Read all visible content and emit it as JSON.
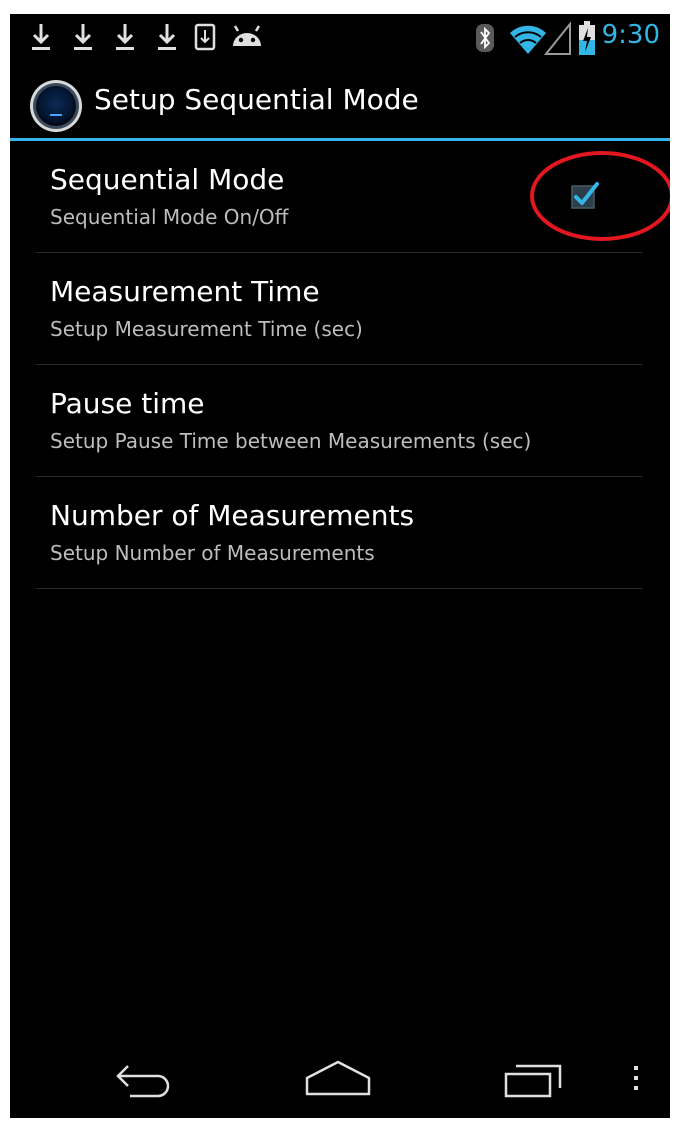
{
  "status_bar": {
    "notification_icons": [
      "download-icon",
      "download-icon",
      "download-icon",
      "download-icon",
      "sd-download-icon",
      "android-icon"
    ],
    "system_icons": [
      "bluetooth-icon",
      "wifi-icon",
      "signal-icon",
      "battery-charging-icon"
    ],
    "time": "9:30"
  },
  "action_bar": {
    "icon": "app-icon",
    "title": "Setup Sequential Mode"
  },
  "preferences": [
    {
      "title": "Sequential Mode",
      "summary": "Sequential Mode On/Off",
      "checked": true
    },
    {
      "title": "Measurement Time",
      "summary": "Setup Measurement Time (sec)"
    },
    {
      "title": "Pause time",
      "summary": "Setup Pause Time between Measurements (sec)"
    },
    {
      "title": "Number of Measurements",
      "summary": "Setup Number of Measurements"
    }
  ],
  "navigation_bar": {
    "buttons": [
      "back-icon",
      "home-icon",
      "recent-apps-icon",
      "overflow-menu-icon"
    ]
  },
  "colors": {
    "accent": "#33b5e5",
    "annotation": "#e3171f",
    "background": "#000000",
    "title_text": "#ffffff",
    "summary_text": "#bdbdbd"
  }
}
